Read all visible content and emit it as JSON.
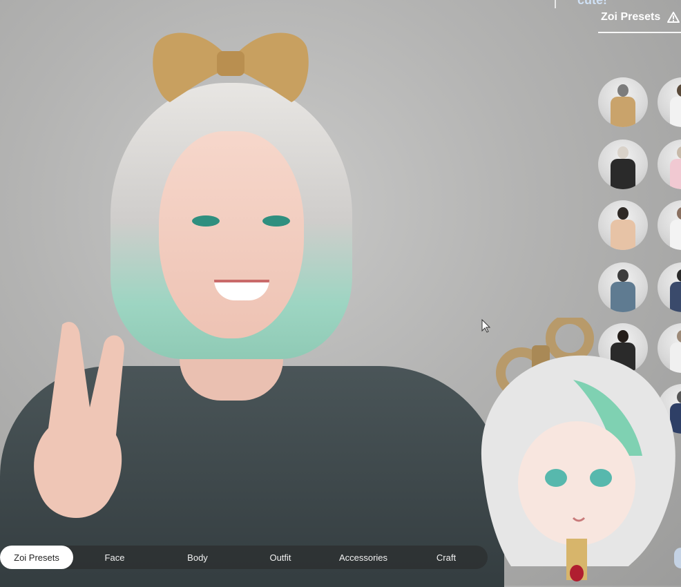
{
  "top_partial_text": "cute!",
  "panel": {
    "title": "Zoi Presets",
    "icon": "warning-icon"
  },
  "presets": [
    {
      "outfit": "#c9a36b",
      "hair": "#7c7c7c"
    },
    {
      "outfit": "#f2f2f2",
      "hair": "#5a4a3a"
    },
    {
      "outfit": "#2a2a2a",
      "hair": "#d9d2c9"
    },
    {
      "outfit": "#f1c9d2",
      "hair": "#c7b9a8"
    },
    {
      "outfit": "#e7c3a6",
      "hair": "#2f2a26"
    },
    {
      "outfit": "#f3f3f3",
      "hair": "#8a7060"
    },
    {
      "outfit": "#5f7b91",
      "hair": "#3d3d3d"
    },
    {
      "outfit": "#3a4a6b",
      "hair": "#2a2a2a"
    },
    {
      "outfit": "#2a2a2a",
      "hair": "#241d19"
    },
    {
      "outfit": "#f0f0f0",
      "hair": "#9d8a78"
    },
    {
      "outfit": "#2e3f66",
      "hair": "#555"
    }
  ],
  "tabs": [
    {
      "label": "Zoi Presets",
      "active": true
    },
    {
      "label": "Face",
      "active": false
    },
    {
      "label": "Body",
      "active": false
    },
    {
      "label": "Outfit",
      "active": false
    },
    {
      "label": "Accessories",
      "active": false
    },
    {
      "label": "Craft",
      "active": false
    }
  ],
  "colors": {
    "accent_white": "#ffffff",
    "tabbar_bg": "rgba(40,40,40,0.55)"
  }
}
